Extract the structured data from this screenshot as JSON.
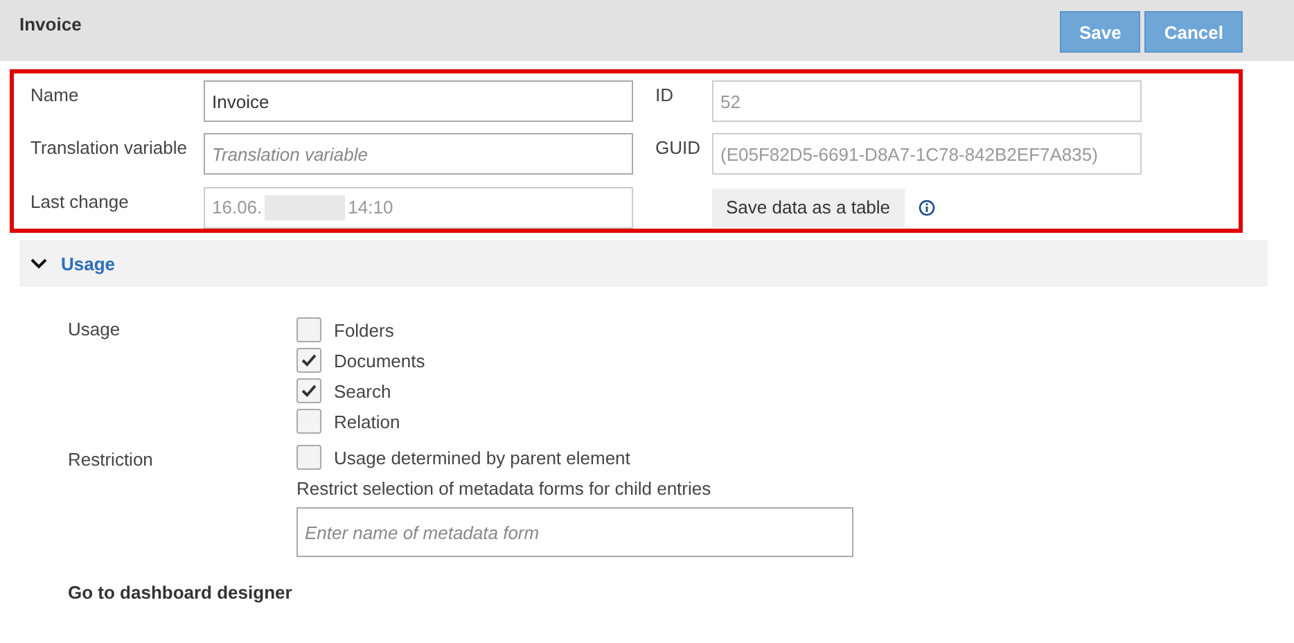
{
  "header": {
    "title": "Invoice",
    "buttons": [
      {
        "label": "Save"
      },
      {
        "label": "Cancel"
      }
    ]
  },
  "properties": {
    "name": {
      "label": "Name",
      "value": "Invoice"
    },
    "translation": {
      "label": "Translation variable",
      "placeholder": "Translation variable"
    },
    "last_change": {
      "label": "Last change",
      "value_start": "16.06.",
      "value_end": "14:10",
      "redacted": true
    },
    "id": {
      "label": "ID",
      "value": "52"
    },
    "guid": {
      "label": "GUID",
      "value": "(E05F82D5-6691-D8A7-1C78-842B2EF7A835)"
    },
    "save_table_button": "Save data as a table"
  },
  "usage_section": {
    "title": "Usage",
    "expanded": true,
    "usage_label": "Usage",
    "options": [
      {
        "label": "Folders",
        "checked": false
      },
      {
        "label": "Documents",
        "checked": true
      },
      {
        "label": "Search",
        "checked": true
      },
      {
        "label": "Relation",
        "checked": false
      }
    ],
    "restriction_label": "Restriction",
    "restriction": {
      "label": "Usage determined by parent element",
      "checked": false
    },
    "restrict_text": "Restrict selection of metadata forms for child entries",
    "metadata_field": {
      "placeholder": "Enter name of metadata form"
    },
    "dashboard_link": "Go to dashboard designer"
  }
}
